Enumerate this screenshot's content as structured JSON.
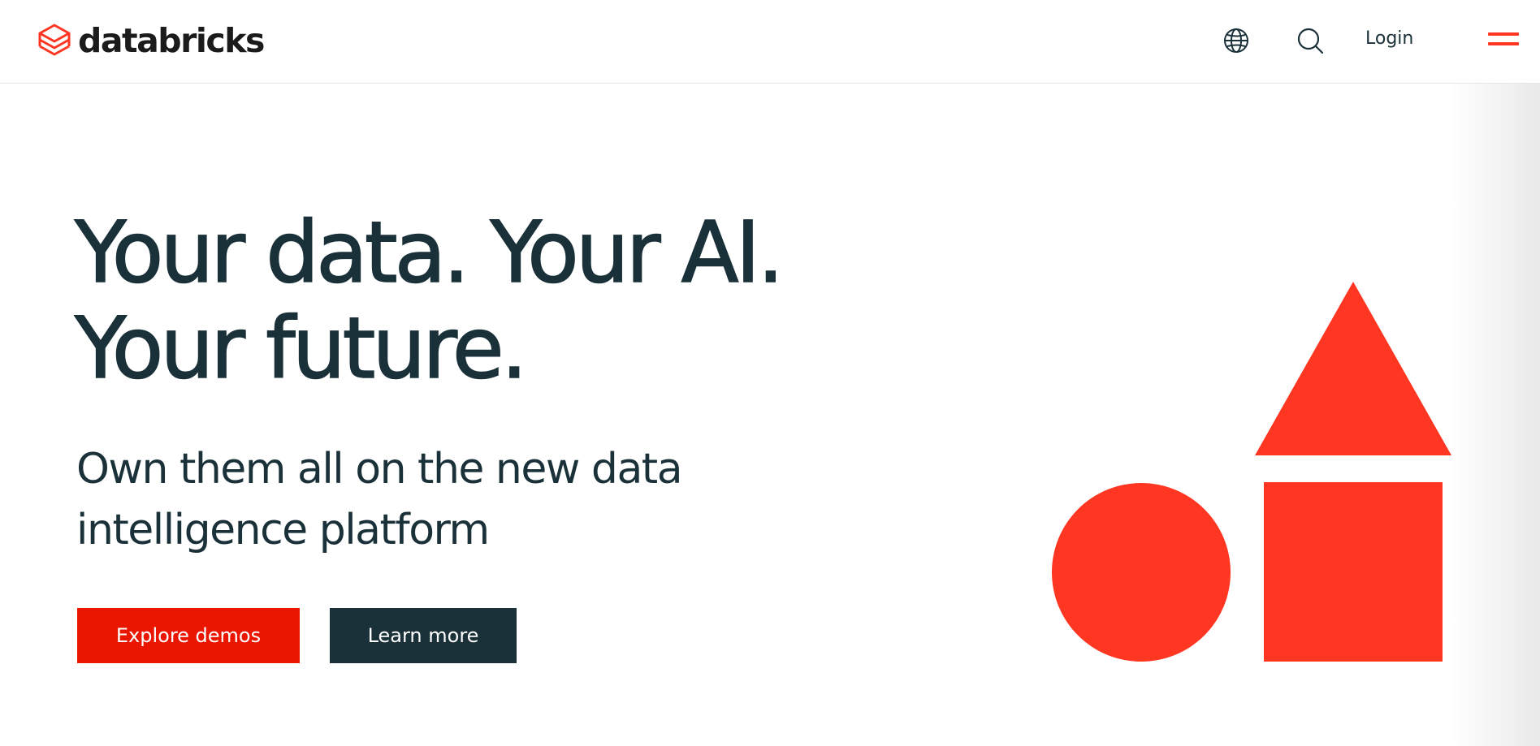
{
  "header": {
    "logo_text": "databricks",
    "globe_icon": "globe-icon",
    "search_icon": "search-icon",
    "login_label": "Login",
    "menu_icon": "hamburger-menu-icon"
  },
  "hero": {
    "title_line1": "Your data. Your AI.",
    "title_line2": "Your future.",
    "subtitle_line1": "Own them all on the new data",
    "subtitle_line2": "intelligence platform",
    "primary_button": "Explore demos",
    "secondary_button": "Learn more"
  },
  "colors": {
    "brand_red": "#ff3621",
    "primary_button_bg": "#eb1600",
    "dark_navy": "#1b3139",
    "background": "#ffffff"
  },
  "illustration": {
    "shapes": [
      "triangle",
      "circle",
      "square"
    ]
  }
}
